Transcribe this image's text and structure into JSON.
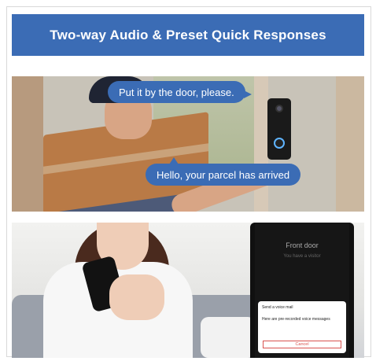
{
  "banner": {
    "title": "Two-way Audio & Preset Quick Responses"
  },
  "scene1": {
    "bubble_top": "Put it by the door, please.",
    "bubble_bottom": "Hello, your parcel has arrived"
  },
  "scene2": {
    "phone": {
      "title": "Front door",
      "subtitle": "You have a visitor",
      "sheet_title": "Send a voice mail",
      "sheet_message": "Here are pre-recorded voice messages",
      "cancel_label": "Cancel"
    }
  },
  "colors": {
    "accent": "#3b6cb5",
    "cancel": "#d9534f"
  }
}
